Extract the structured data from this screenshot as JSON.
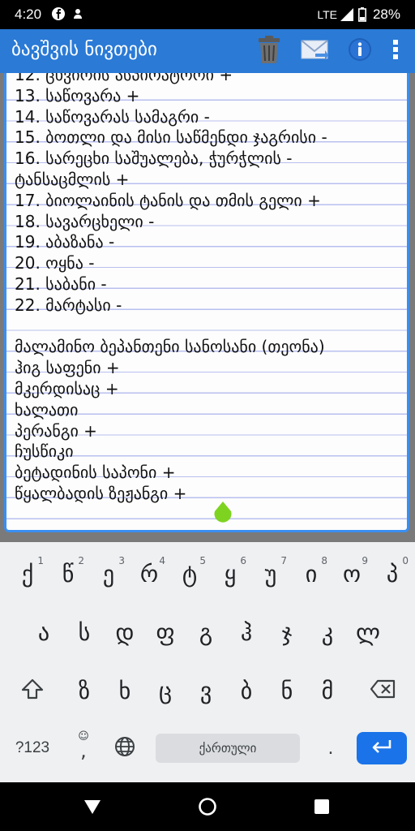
{
  "status_bar": {
    "time": "4:20",
    "network": "LTE",
    "battery": "28%"
  },
  "app_bar": {
    "title": "ბავშვის ნივთები",
    "actions": [
      "trash-icon",
      "mail-icon",
      "info-icon",
      "more-vert-icon"
    ],
    "color": "#2a7ad6"
  },
  "note": {
    "lines": [
      "12. ცხვირის ასპირატორი +",
      "13. საწოვარა +",
      "14. საწოვარას სამაგრი -",
      "15. ბოთლი და მისი საწმენდი ჯაგრისი -",
      "16. სარეცხი საშუალება, ჭურჭლის -",
      "ტანსაცმლის +",
      "17. ბიოლაინის ტანის და თმის გელი +",
      "18. სავარცხელი -",
      "19. აბაზანა -",
      "20. ოყნა -",
      "21. საბანი -",
      "22. მარტასი -",
      "",
      "მალამინო ბეპანთენი სანოსანი (თეონა)",
      "ჰიგ საფენი +",
      "მკერდისაც +",
      "ხალათი",
      "პერანგი +",
      "ჩუსწიკი",
      "ბეტადინის საპონი +",
      "წყალბადის ზეჟანგი +"
    ]
  },
  "keyboard": {
    "row1": [
      {
        "key": "ქ",
        "hint": "1"
      },
      {
        "key": "წ",
        "hint": "2"
      },
      {
        "key": "ე",
        "hint": "3"
      },
      {
        "key": "რ",
        "hint": "4"
      },
      {
        "key": "ტ",
        "hint": "5"
      },
      {
        "key": "ყ",
        "hint": "6"
      },
      {
        "key": "უ",
        "hint": "7"
      },
      {
        "key": "ი",
        "hint": "8"
      },
      {
        "key": "ო",
        "hint": "9"
      },
      {
        "key": "პ",
        "hint": "0"
      }
    ],
    "row2": [
      "ა",
      "ს",
      "დ",
      "ფ",
      "გ",
      "ჰ",
      "ჯ",
      "კ",
      "ლ"
    ],
    "row3": [
      "ზ",
      "ხ",
      "ც",
      "ვ",
      "ბ",
      "ნ",
      "მ"
    ],
    "symbols_label": "?123",
    "comma": ",",
    "period": ".",
    "space_label": "ქართული",
    "enter_color": "#1a73e8"
  }
}
